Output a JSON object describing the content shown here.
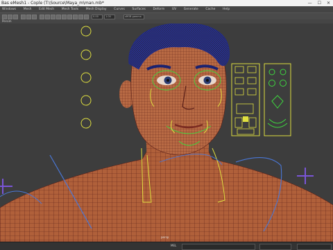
{
  "window": {
    "title": "Bas eMesh1 - Cople (T:\\Source\\Maya_m\\man.mb*",
    "minimize": "—",
    "maximize": "☐",
    "close": "✕"
  },
  "menu": {
    "items": [
      "Windows",
      "Mesh",
      "Edit Mesh",
      "Mesh Tools",
      "Mesh Display",
      "Curves",
      "Surfaces",
      "Deform",
      "UV",
      "Generate",
      "Cache",
      "Help"
    ]
  },
  "shelf": {
    "field_a": "0.00",
    "field_b": "1.00",
    "field_c": "sRGB gamma"
  },
  "panel": {
    "label": "Persim"
  },
  "viewport": {
    "camera_label": "persp"
  },
  "status": {
    "mel_label": "MEL"
  },
  "colors": {
    "skin": "#b0603a",
    "wire": "#5a1f18",
    "hair": "#1f2a8a",
    "rig_yellow": "#e0e040",
    "rig_green": "#3ed83e",
    "rig_blue": "#4a78d8",
    "background": "#3d3d3d"
  }
}
